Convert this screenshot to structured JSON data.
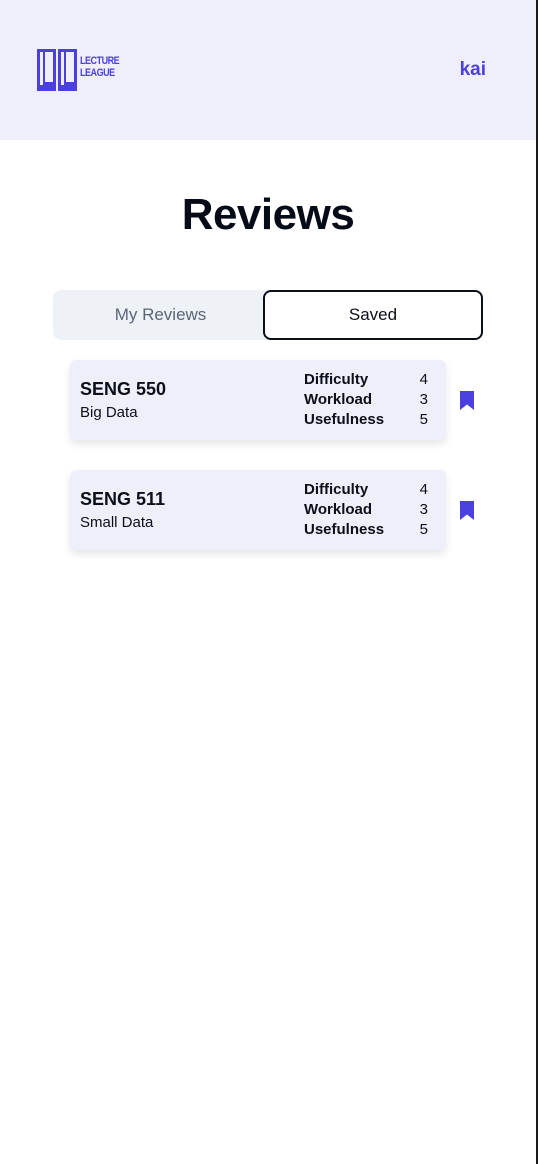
{
  "header": {
    "logo_line1": "LECTURE",
    "logo_line2": "LEAGUE",
    "user_name": "kai"
  },
  "page_title": "Reviews",
  "tabs": [
    {
      "label": "My Reviews",
      "active": false
    },
    {
      "label": "Saved",
      "active": true
    }
  ],
  "colors": {
    "accent": "#4c3fe0",
    "header_bg": "#efeffb",
    "card_bg": "#efeffb",
    "tab_bg": "#eef1f5"
  },
  "reviews": [
    {
      "code": "SENG 550",
      "name": "Big Data",
      "metrics": [
        {
          "label": "Difficulty",
          "value": "4"
        },
        {
          "label": "Workload",
          "value": "3"
        },
        {
          "label": "Usefulness",
          "value": "5"
        }
      ],
      "bookmark_icon": "bookmark-filled-icon"
    },
    {
      "code": "SENG 511",
      "name": "Small Data",
      "metrics": [
        {
          "label": "Difficulty",
          "value": "4"
        },
        {
          "label": "Workload",
          "value": "3"
        },
        {
          "label": "Usefulness",
          "value": "5"
        }
      ],
      "bookmark_icon": "bookmark-filled-icon"
    }
  ]
}
